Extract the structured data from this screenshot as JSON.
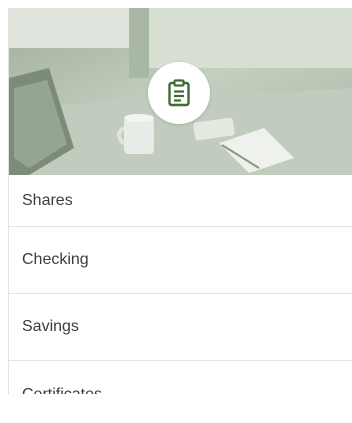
{
  "hero": {
    "icon": "clipboard-icon",
    "icon_color": "#3f6b35"
  },
  "menu": {
    "items": [
      {
        "label": "Shares"
      },
      {
        "label": "Checking"
      },
      {
        "label": "Savings"
      },
      {
        "label": "Certificates"
      }
    ]
  }
}
